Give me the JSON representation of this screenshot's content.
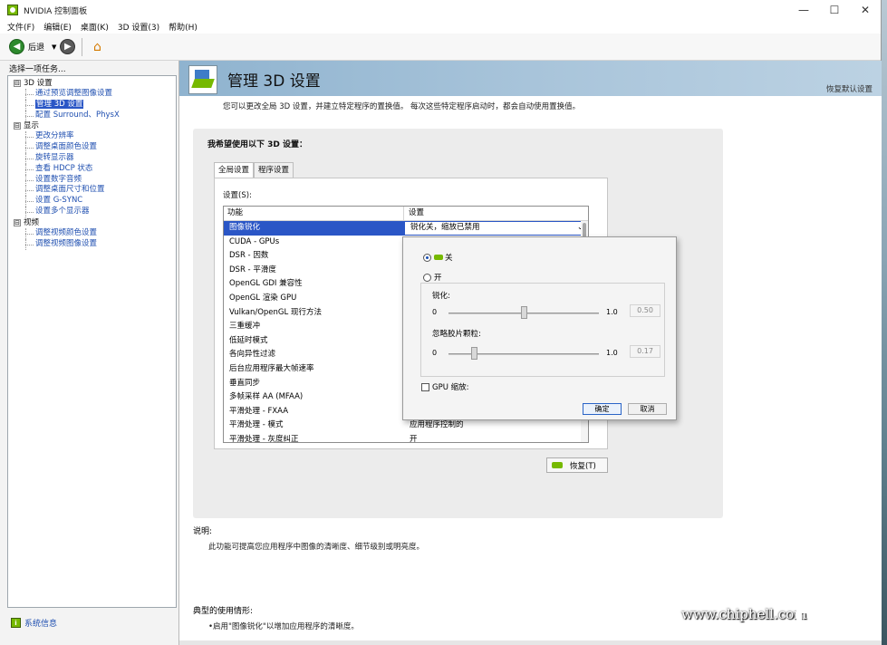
{
  "window": {
    "title": "NVIDIA 控制面板",
    "minimize": "—",
    "maximize": "☐",
    "close": "✕"
  },
  "menu": [
    "文件(F)",
    "编辑(E)",
    "桌面(K)",
    "3D 设置(3)",
    "帮助(H)"
  ],
  "toolbar": {
    "back_label": "后退",
    "back_icon": "back-arrow-icon",
    "forward_icon": "forward-arrow-icon",
    "home_icon": "home-icon"
  },
  "left_pane": {
    "task_label": "选择一项任务...",
    "categories": [
      {
        "label": "3D 设置",
        "expander": "⊟",
        "items": [
          "通过预览调整图像设置",
          "管理 3D 设置",
          "配置 Surround、PhysX"
        ]
      },
      {
        "label": "显示",
        "expander": "⊟",
        "items": [
          "更改分辨率",
          "调整桌面颜色设置",
          "旋转显示器",
          "查看 HDCP 状态",
          "设置数字音频",
          "调整桌面尺寸和位置",
          "设置 G-SYNC",
          "设置多个显示器"
        ]
      },
      {
        "label": "视频",
        "expander": "⊟",
        "items": [
          "调整视频颜色设置",
          "调整视频图像设置"
        ]
      }
    ],
    "selected_item": "管理 3D 设置",
    "system_info": "系统信息"
  },
  "header": {
    "title": "管理 3D 设置",
    "restore_defaults": "恢复默认设置",
    "intro": "您可以更改全局 3D 设置，并建立特定程序的置换值。 每次这些特定程序启动时，都会自动使用置换值。"
  },
  "panel": {
    "heading": "我希望使用以下 3D 设置：",
    "tabs": [
      "全局设置",
      "程序设置"
    ],
    "settings_label": "设置(S):",
    "columns": [
      "功能",
      "设置"
    ],
    "rows": [
      {
        "feature": "图像锐化",
        "setting": "锐化关，缩放已禁用"
      },
      {
        "feature": "CUDA - GPUs",
        "setting": ""
      },
      {
        "feature": "DSR - 因数",
        "setting": ""
      },
      {
        "feature": "DSR - 平滑度",
        "setting": ""
      },
      {
        "feature": "OpenGL GDI 兼容性",
        "setting": ""
      },
      {
        "feature": "OpenGL 渲染 GPU",
        "setting": ""
      },
      {
        "feature": "Vulkan/OpenGL 现行方法",
        "setting": ""
      },
      {
        "feature": "三重缓冲",
        "setting": ""
      },
      {
        "feature": "低延时模式",
        "setting": ""
      },
      {
        "feature": "各向异性过滤",
        "setting": ""
      },
      {
        "feature": "后台应用程序最大帧速率",
        "setting": ""
      },
      {
        "feature": "垂直同步",
        "setting": ""
      },
      {
        "feature": "多帧采样 AA (MFAA)",
        "setting": ""
      },
      {
        "feature": "平滑处理 - FXAA",
        "setting": ""
      },
      {
        "feature": "平滑处理 - 模式",
        "setting": "应用程序控制的"
      },
      {
        "feature": "平滑处理 - 灰度纠正",
        "setting": "开"
      }
    ],
    "dropdown_arrow": "⌄",
    "restore_button": "恢复(T)"
  },
  "popup": {
    "option_off": "关",
    "option_on": "开",
    "sharpen_label": "锐化:",
    "sharpen_min": "0",
    "sharpen_max": "1.0",
    "sharpen_value": "0.50",
    "sharpen_level": 0.5,
    "grain_label": "忽略胶片颗粒:",
    "grain_min": "0",
    "grain_max": "1.0",
    "grain_value": "0.17",
    "grain_level": 0.17,
    "gpu_scaling": "GPU 缩放:",
    "ok": "确定",
    "cancel": "取消"
  },
  "description": {
    "label": "说明:",
    "text": "此功能可提高您应用程序中图像的清晰度、细节级别或明亮度。"
  },
  "usage": {
    "label": "典型的使用情形:",
    "text": "•启用\"图像锐化\"以增加应用程序的清晰度。"
  },
  "watermark": {
    "url": "www.chiphell.com",
    "logo_text": "chip hell"
  }
}
